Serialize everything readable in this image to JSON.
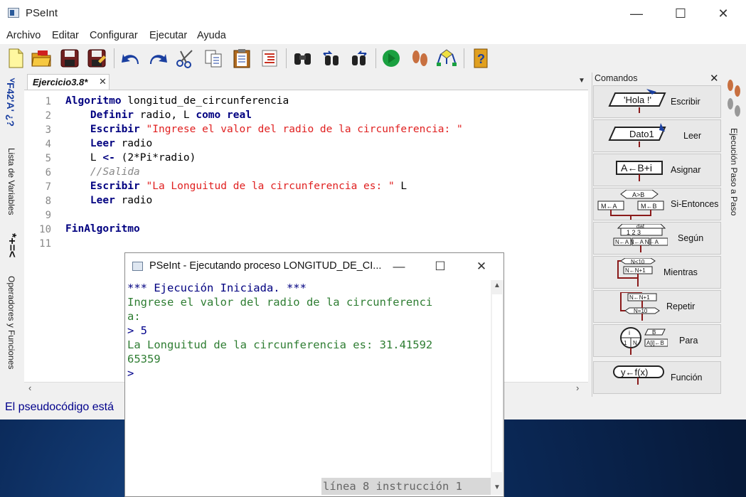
{
  "window": {
    "title": "PSeInt"
  },
  "menu": [
    "Archivo",
    "Editar",
    "Configurar",
    "Ejecutar",
    "Ayuda"
  ],
  "tab": {
    "label": "Ejercicio3.8*",
    "close": "✕"
  },
  "left_strip": {
    "vars_label": "Lista de Variables",
    "ops_label": "Operadores y Funciones",
    "vars_glyph": "ⱽF42'A' ¿?",
    "ops_glyph": "*+=<"
  },
  "code": {
    "line_numbers": [
      "1",
      "2",
      "3",
      "4",
      "5",
      "6",
      "7",
      "8",
      "9",
      "10",
      "11"
    ],
    "lines": [
      {
        "kw1": "Algoritmo",
        "rest": " longitud_de_circunferencia"
      },
      {
        "indent": "    ",
        "kw1": "Definir",
        "rest": " radio, L ",
        "kw2": "como",
        "sp": " ",
        "kw3": "real"
      },
      {
        "indent": "    ",
        "kw1": "Escribir",
        "sp": " ",
        "str": "\"Ingrese el valor del radio de la circunferencia: \""
      },
      {
        "indent": "    ",
        "kw1": "Leer",
        "rest": " radio"
      },
      {
        "indent": "    ",
        "pre": "L ",
        "kw1": "<-",
        "rest": " (2*Pi*radio)"
      },
      {
        "indent": "    ",
        "cm": "//Salida"
      },
      {
        "indent": "    ",
        "kw1": "Escribir",
        "sp": " ",
        "str": "\"La Longuitud de la circunferencia es: \"",
        "rest": " L"
      },
      {
        "indent": "    ",
        "kw1": "Leer",
        "rest": " radio"
      },
      {},
      {
        "kw1": "FinAlgoritmo"
      },
      {}
    ]
  },
  "status": {
    "text": "El pseudocódigo está"
  },
  "commands": {
    "title": "Comandos",
    "close": "✕",
    "items": [
      {
        "label": "Escribir",
        "glyph": "'Hola !'"
      },
      {
        "label": "Leer",
        "glyph": "Dato1"
      },
      {
        "label": "Asignar",
        "glyph": "A←B+i"
      },
      {
        "label": "Si-Entonces",
        "glyph": "A>B"
      },
      {
        "label": "Según",
        "glyph": "dat"
      },
      {
        "label": "Mientras",
        "glyph": "N<10"
      },
      {
        "label": "Repetir",
        "glyph": "N←N+1"
      },
      {
        "label": "Para",
        "glyph": "i"
      },
      {
        "label": "Función",
        "glyph": "y←f(x)"
      }
    ]
  },
  "right_strip": {
    "label": "Ejecución Paso a Paso"
  },
  "run_window": {
    "title": "PSeInt - Ejecutando proceso LONGITUD_DE_CI...",
    "console": [
      {
        "cls": "blue",
        "text": "*** Ejecución Iniciada. ***"
      },
      {
        "cls": "green",
        "text": "Ingrese el valor del radio de la circunferenci"
      },
      {
        "cls": "green",
        "text": "a:"
      },
      {
        "cls": "input",
        "text": "> 5"
      },
      {
        "cls": "green",
        "text": "La Longuitud de la circunferencia es: 31.41592"
      },
      {
        "cls": "green",
        "text": "65359"
      },
      {
        "cls": "input",
        "text": ">"
      }
    ],
    "status": "línea 8 instrucción 1"
  },
  "colors": {
    "keyword": "#000080",
    "string": "#e02020",
    "comment": "#888888",
    "console_green": "#2e7d32",
    "console_blue": "#000080"
  }
}
